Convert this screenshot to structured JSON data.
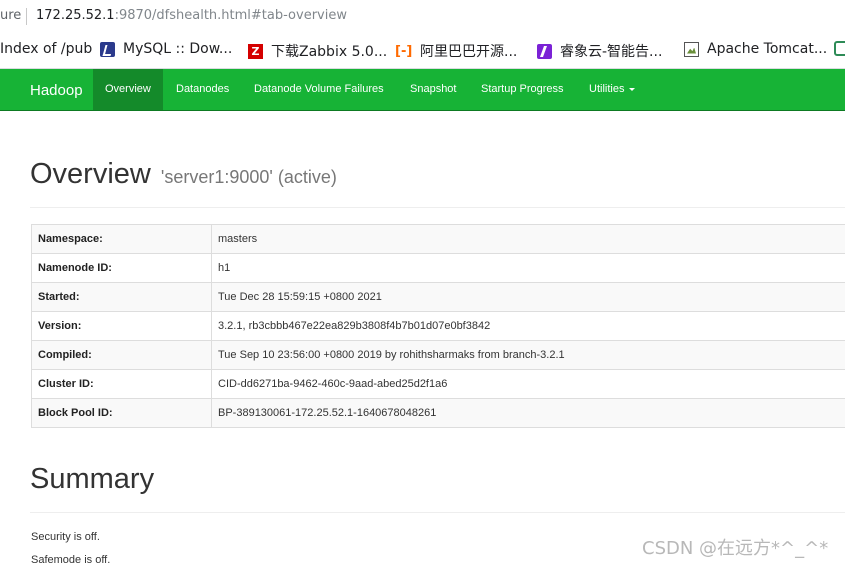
{
  "browser": {
    "secure_label": "ure",
    "url_host": "172.25.52.1",
    "url_path": ":9870/dfshealth.html#tab-overview",
    "bookmarks": [
      {
        "label": "Index of /pub",
        "icon": "none"
      },
      {
        "label": "MySQL :: Dow...",
        "icon": "mysql-icon"
      },
      {
        "label": "下载Zabbix 5.0...",
        "icon": "zabbix-icon"
      },
      {
        "label": "阿里巴巴开源...",
        "icon": "alibaba-icon"
      },
      {
        "label": "睿象云-智能告...",
        "icon": "ruixiang-icon"
      },
      {
        "label": "Apache Tomcat...",
        "icon": "tomcat-icon"
      }
    ],
    "zabbix_glyph": "Z",
    "alibaba_glyph": "[-]"
  },
  "navbar": {
    "brand": "Hadoop",
    "items": [
      {
        "label": "Overview",
        "active": true
      },
      {
        "label": "Datanodes"
      },
      {
        "label": "Datanode Volume Failures"
      },
      {
        "label": "Snapshot"
      },
      {
        "label": "Startup Progress"
      },
      {
        "label": "Utilities"
      }
    ]
  },
  "overview": {
    "title": "Overview",
    "subtitle": "'server1:9000' (active)",
    "rows": [
      {
        "key": "Namespace:",
        "value": "masters"
      },
      {
        "key": "Namenode ID:",
        "value": "h1"
      },
      {
        "key": "Started:",
        "value": "Tue Dec 28 15:59:15 +0800 2021"
      },
      {
        "key": "Version:",
        "value": "3.2.1, rb3cbbb467e22ea829b3808f4b7b01d07e0bf3842"
      },
      {
        "key": "Compiled:",
        "value": "Tue Sep 10 23:56:00 +0800 2019 by rohithsharmaks from branch-3.2.1"
      },
      {
        "key": "Cluster ID:",
        "value": "CID-dd6271ba-9462-460c-9aad-abed25d2f1a6"
      },
      {
        "key": "Block Pool ID:",
        "value": "BP-389130061-172.25.52.1-1640678048261"
      }
    ]
  },
  "summary": {
    "title": "Summary",
    "security": "Security is off.",
    "safemode": "Safemode is off."
  },
  "watermark": "CSDN @在远方*^_^*",
  "colors": {
    "navbar": "#17b336",
    "navbar_active": "#148a2a"
  }
}
